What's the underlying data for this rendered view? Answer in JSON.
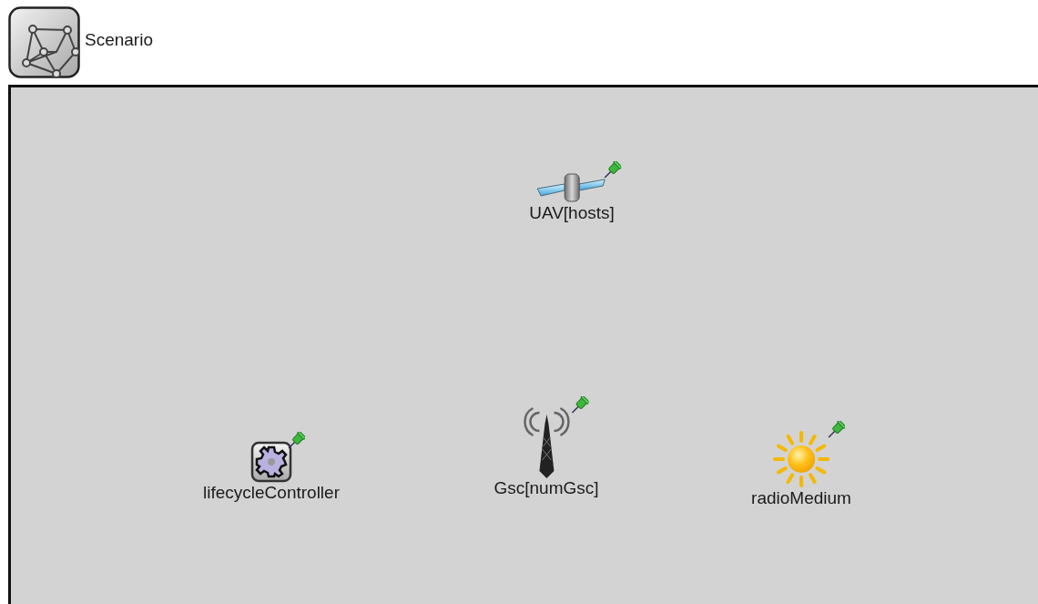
{
  "title": "Scenario",
  "nodes": [
    {
      "kind": "satellite",
      "label": "UAV[hosts]",
      "pinned": true
    },
    {
      "kind": "gear",
      "label": "lifecycleController",
      "pinned": true
    },
    {
      "kind": "tower",
      "label": "Gsc[numGsc]",
      "pinned": true
    },
    {
      "kind": "sun",
      "label": "radioMedium",
      "pinned": true
    }
  ]
}
